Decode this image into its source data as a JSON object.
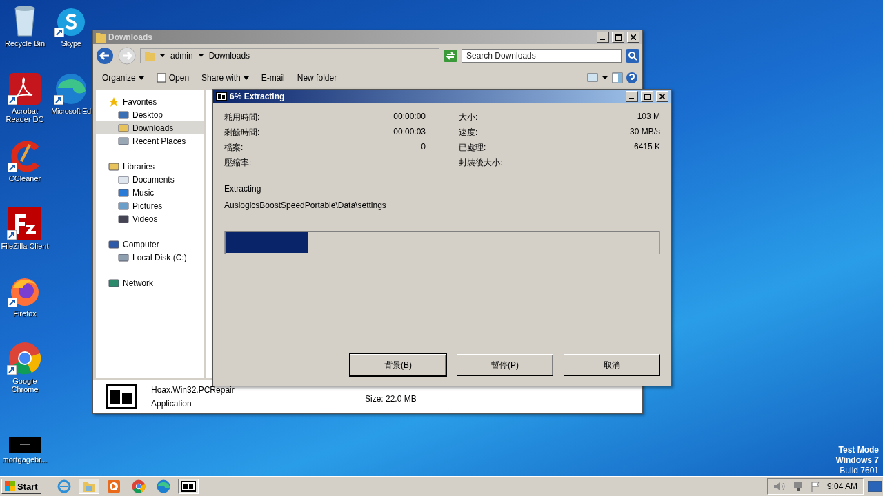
{
  "desktop_columns": [
    [
      {
        "label": "Recycle Bin",
        "kind": "recycle",
        "shortcut": false
      },
      {
        "label": "Acrobat Reader DC",
        "kind": "acrobat",
        "shortcut": true
      },
      {
        "label": "CCleaner",
        "kind": "ccleaner",
        "shortcut": true
      },
      {
        "label": "FileZilla Client",
        "kind": "filezilla",
        "shortcut": true
      },
      {
        "label": "Firefox",
        "kind": "firefox",
        "shortcut": true
      },
      {
        "label": "Google Chrome",
        "kind": "chrome",
        "shortcut": true
      },
      {
        "label": "mortgagebr...",
        "kind": "blank",
        "shortcut": false
      }
    ],
    [
      {
        "label": "Skype",
        "kind": "skype",
        "shortcut": true
      },
      {
        "label": "Microsoft Ed",
        "kind": "edge",
        "shortcut": true
      }
    ]
  ],
  "explorer": {
    "title": "Downloads",
    "breadcrumb": [
      "admin",
      "Downloads"
    ],
    "search": {
      "placeholder": "Search Downloads"
    },
    "toolbar": [
      {
        "label": "Organize",
        "dropdown": true,
        "kind": "plain"
      },
      {
        "label": "Open",
        "dropdown": false,
        "kind": "open"
      },
      {
        "label": "Share with",
        "dropdown": true,
        "kind": "plain"
      },
      {
        "label": "E-mail",
        "dropdown": false,
        "kind": "plain"
      },
      {
        "label": "New folder",
        "dropdown": false,
        "kind": "plain"
      }
    ],
    "nav": [
      {
        "label": "Favorites",
        "kind": "star",
        "selected": false,
        "children": [
          {
            "label": "Desktop",
            "kind": "desktop",
            "selected": false
          },
          {
            "label": "Downloads",
            "kind": "folder",
            "selected": true
          },
          {
            "label": "Recent Places",
            "kind": "recent",
            "selected": false
          }
        ]
      },
      {
        "label": "Libraries",
        "kind": "library",
        "selected": false,
        "children": [
          {
            "label": "Documents",
            "kind": "doc",
            "selected": false
          },
          {
            "label": "Music",
            "kind": "music",
            "selected": false
          },
          {
            "label": "Pictures",
            "kind": "pictures",
            "selected": false
          },
          {
            "label": "Videos",
            "kind": "videos",
            "selected": false
          }
        ]
      },
      {
        "label": "Computer",
        "kind": "computer",
        "selected": false,
        "children": [
          {
            "label": "Local Disk (C:)",
            "kind": "disk",
            "selected": false
          }
        ]
      },
      {
        "label": "Network",
        "kind": "network",
        "selected": false
      }
    ],
    "details": {
      "name": "Hoax.Win32.PCRepair",
      "type": "Application",
      "size": "Size: 22.0 MB"
    }
  },
  "dialog": {
    "title": "6% Extracting",
    "stats_left": [
      {
        "label": "耗用時間:",
        "value": "00:00:00"
      },
      {
        "label": "剩餘時間:",
        "value": "00:00:03"
      },
      {
        "label": "檔案:",
        "value": "0"
      },
      {
        "label": "壓縮率:"
      }
    ],
    "stats_right": [
      {
        "label": "大小:",
        "value": "103 M"
      },
      {
        "label": "速度:",
        "value": "30 MB/s"
      },
      {
        "label": "已處理:",
        "value": "6415 K"
      },
      {
        "label": "封裝後大小:"
      }
    ],
    "status": "Extracting",
    "file": "AuslogicsBoostSpeedPortable\\Data\\settings",
    "progress": {
      "level": 0.19
    },
    "buttons": [
      "背景(B)",
      "暫停(P)",
      "取消"
    ]
  },
  "system_text": [
    "Test Mode",
    "Windows 7",
    "Build 7601"
  ],
  "taskbar": {
    "start": "Start",
    "apps": [
      {
        "kind": "ie",
        "selected": false
      },
      {
        "kind": "explorer",
        "selected": true
      },
      {
        "kind": "media",
        "selected": false
      },
      {
        "kind": "chrome",
        "selected": false
      },
      {
        "kind": "edge",
        "selected": false
      },
      {
        "kind": "archive",
        "selected": true
      }
    ],
    "time": "9:04 AM"
  }
}
